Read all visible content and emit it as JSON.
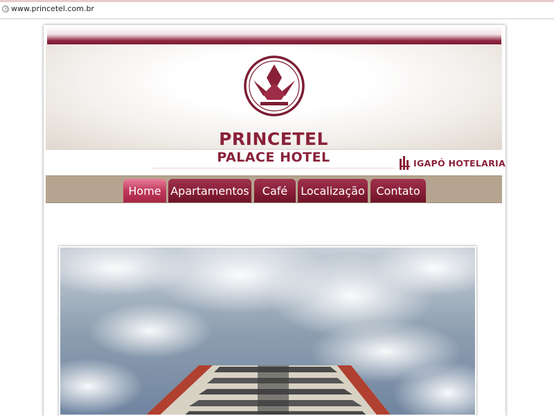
{
  "browser": {
    "url": "www.princetel.com.br"
  },
  "header": {
    "brand_line1": "PRINCETEL",
    "brand_line2": "PALACE HOTEL",
    "partner": "IGAPÓ HOTELARIA"
  },
  "nav": {
    "items": [
      {
        "label": "Home",
        "active": true
      },
      {
        "label": "Apartamentos",
        "active": false
      },
      {
        "label": "Café",
        "active": false
      },
      {
        "label": "Localização",
        "active": false
      },
      {
        "label": "Contato",
        "active": false
      }
    ]
  },
  "colors": {
    "brand": "#8a2139",
    "nav_bar": "#b5a48f",
    "tab_active": "#c0395c"
  },
  "icons": [
    "globe-icon",
    "crown-logo",
    "igapo-logo-mark"
  ]
}
